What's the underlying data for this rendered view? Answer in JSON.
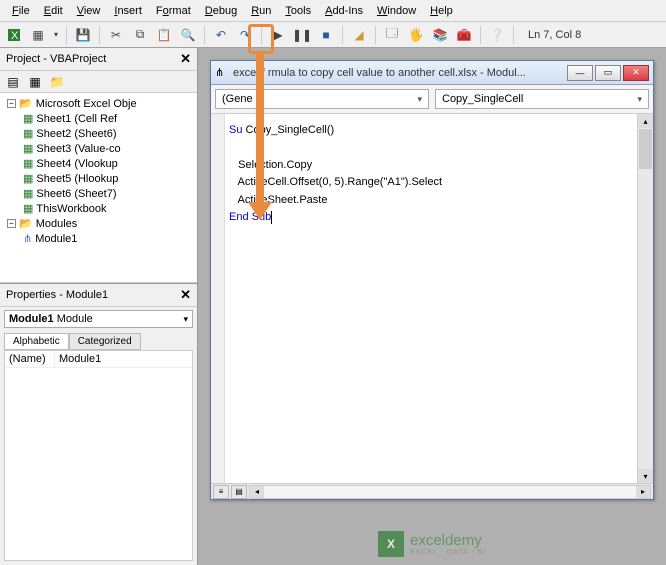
{
  "menu": {
    "items": [
      "File",
      "Edit",
      "View",
      "Insert",
      "Format",
      "Debug",
      "Run",
      "Tools",
      "Add-Ins",
      "Window",
      "Help"
    ]
  },
  "toolbar": {
    "cursor_pos": "Ln 7, Col 8"
  },
  "project_pane": {
    "title": "Project - VBAProject",
    "root": "Microsoft Excel Obje",
    "sheets": [
      "Sheet1 (Cell Ref",
      "Sheet2 (Sheet6)",
      "Sheet3 (Value-co",
      "Sheet4 (Vlookup",
      "Sheet5 (Hlookup",
      "Sheet6 (Sheet7)",
      "ThisWorkbook"
    ],
    "modules_label": "Modules",
    "modules": [
      "Module1"
    ]
  },
  "properties_pane": {
    "title": "Properties - Module1",
    "combo_name": "Module1",
    "combo_type": "Module",
    "tabs": [
      "Alphabetic",
      "Categorized"
    ],
    "rows": [
      {
        "k": "(Name)",
        "v": "Module1"
      }
    ]
  },
  "code_window": {
    "title": "excel f  rmula to copy cell value to another cell.xlsx - Modul...",
    "left_combo": "(Gene",
    "right_combo": "Copy_SingleCell",
    "code": {
      "l1_kw": "Su",
      "l1_rest": " Copy_SingleCell()",
      "l2": "",
      "l3": "   Selection.Copy",
      "l4": "   ActiveCell.Offset(0, 5).Range(\"A1\").Select",
      "l5": "   ActiveSheet.Paste",
      "l6_kw": "End Sub"
    }
  },
  "watermark": {
    "brand": "exceldemy",
    "sub": "EXCEL · DATA · BI"
  }
}
